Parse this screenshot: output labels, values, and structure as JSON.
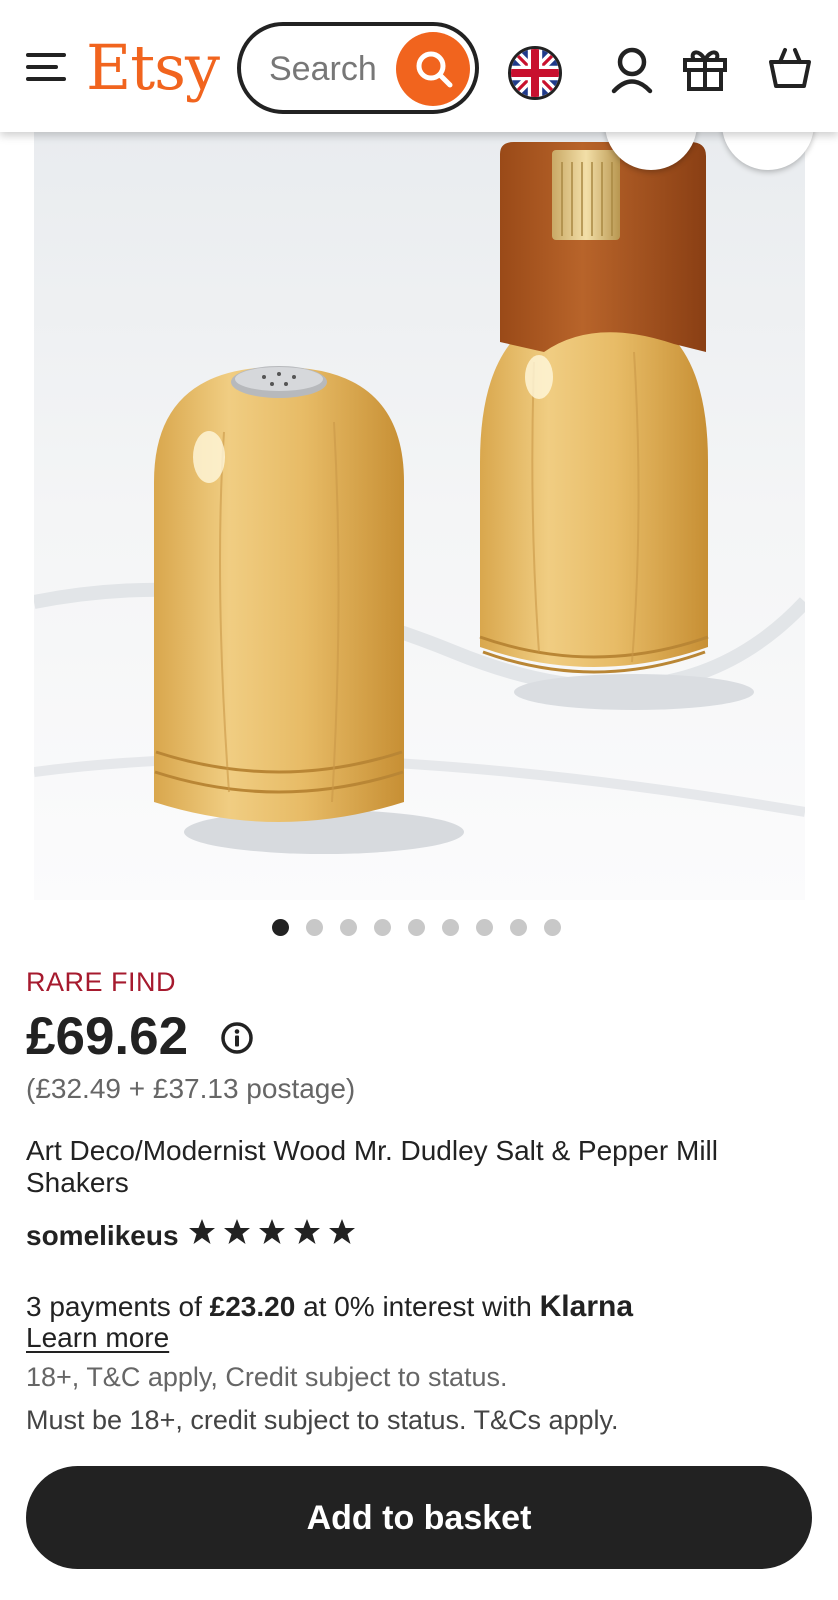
{
  "header": {
    "logo": "Etsy",
    "search_placeholder": "Search"
  },
  "icons": {
    "menu": "hamburger-menu-icon",
    "search": "search-icon",
    "flag": "uk-flag-icon",
    "account": "user-icon",
    "gift": "gift-icon",
    "basket": "basket-icon",
    "info": "info-icon",
    "star": "star-icon"
  },
  "gallery": {
    "image_count": 9,
    "active_index": 0
  },
  "product": {
    "badge": "RARE FIND",
    "price": "£69.62",
    "price_breakdown": "(£32.49 + £37.13 postage)",
    "title": "Art Deco/Modernist Wood Mr. Dudley Salt & Pepper Mill Shakers",
    "shop_name": "somelikeus",
    "rating_stars": 5
  },
  "payment": {
    "prefix": "3 payments of ",
    "amount": "£23.20",
    "middle": " at 0% interest with ",
    "provider": "Klarna",
    "learn_more": "Learn more",
    "fine_print_1": "18+, T&C apply, Credit subject to status.",
    "fine_print_2": "Must be 18+, credit subject to status. T&Cs apply."
  },
  "cta": {
    "add_to_basket": "Add to basket"
  },
  "colors": {
    "brand": "#F1641E",
    "rare_find": "#A61A2E",
    "dark": "#222222"
  }
}
